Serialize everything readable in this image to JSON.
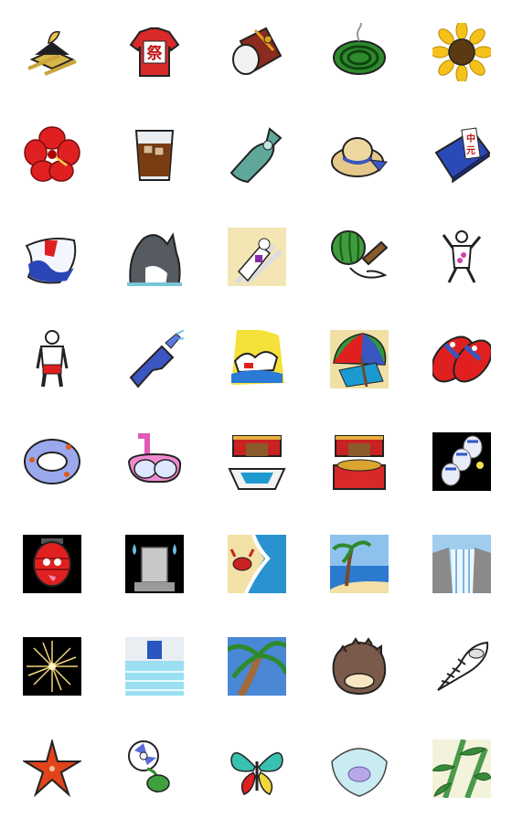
{
  "sheet": {
    "rows": 8,
    "columns": 5,
    "background": "#ffffff"
  },
  "labels": {
    "matsuri_kanji": "祭",
    "chugen_kanji_1": "中",
    "chugen_kanji_2": "元"
  },
  "icons": [
    [
      "mikoshi-shrine-icon",
      "matsuri-happi-shirt-icon",
      "taiko-drum-icon",
      "mosquito-coil-icon",
      "sunflower-icon"
    ],
    [
      "hibiscus-icon",
      "iced-barley-tea-icon",
      "ramune-bottle-icon",
      "straw-hat-icon",
      "chugen-gift-box-icon"
    ],
    [
      "shaved-ice-flag-icon",
      "orca-icon",
      "sunbathing-lounger-icon",
      "watermelon-split-icon",
      "dancing-person-icon"
    ],
    [
      "swimsuit-person-icon",
      "water-gun-icon",
      "beach-rescue-icon",
      "beach-umbrella-icon",
      "beach-sandals-icon"
    ],
    [
      "swim-ring-icon",
      "snorkel-mask-icon",
      "treasure-chest-open-icon",
      "treasure-chest-coins-icon",
      "paper-lanterns-icon"
    ],
    [
      "chochin-ghost-icon",
      "grave-ghost-icon",
      "crab-shore-icon",
      "palm-beach-icon",
      "waterfall-icon"
    ],
    [
      "firework-icon",
      "swimming-pool-icon",
      "palm-sky-icon",
      "turban-shell-icon",
      "spiral-seashell-icon"
    ],
    [
      "starfish-icon",
      "morning-glory-icon",
      "butterfly-icon",
      "jellyfish-icon",
      "bamboo-icon"
    ]
  ]
}
